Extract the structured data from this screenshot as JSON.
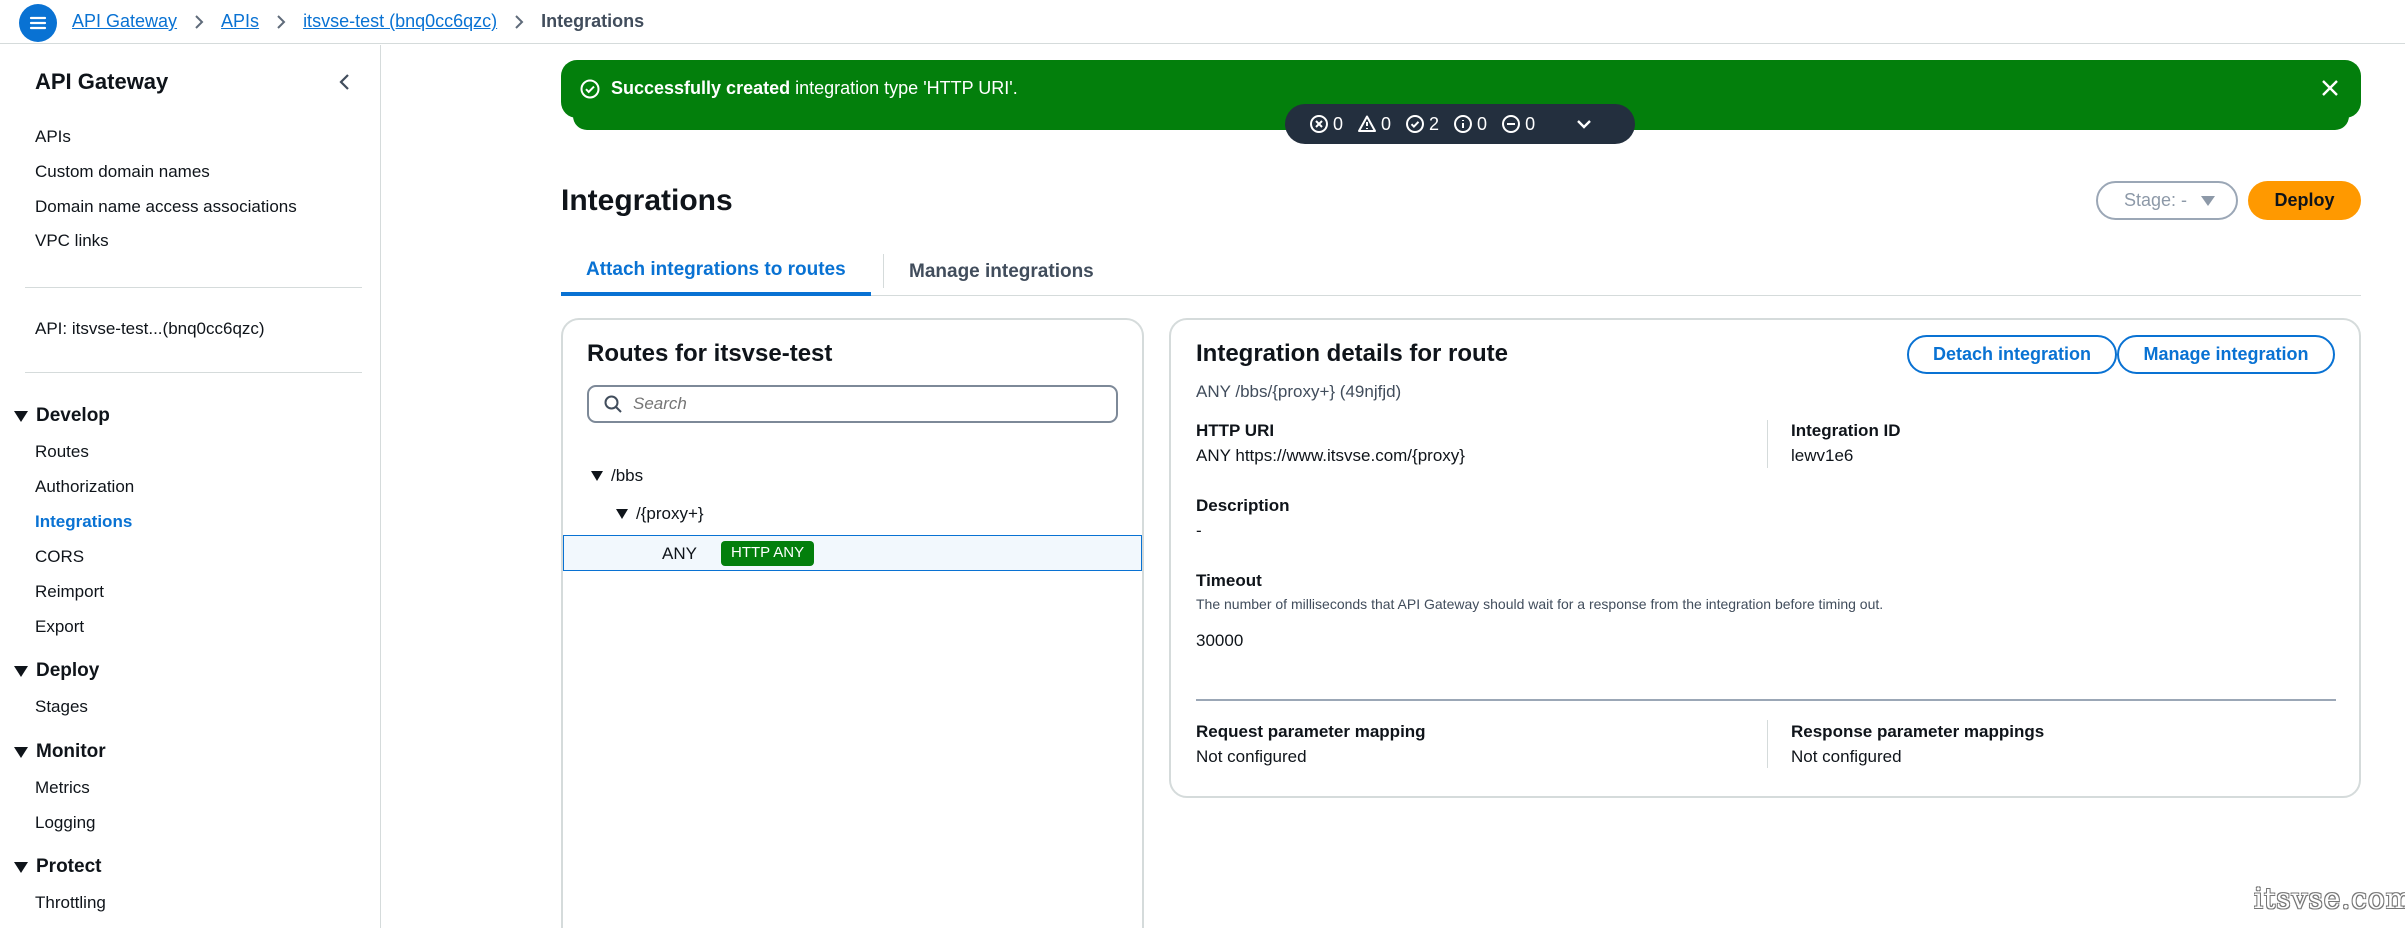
{
  "breadcrumb": {
    "items": [
      "API Gateway",
      "APIs",
      "itsvse-test (bnq0cc6qzc)"
    ],
    "current": "Integrations"
  },
  "sidebar": {
    "title": "API Gateway",
    "top_links": [
      "APIs",
      "Custom domain names",
      "Domain name access associations",
      "VPC links"
    ],
    "api_link": "API: itsvse-test...(bnq0cc6qzc)",
    "sections": [
      {
        "title": "Develop",
        "items": [
          "Routes",
          "Authorization",
          "Integrations",
          "CORS",
          "Reimport",
          "Export"
        ]
      },
      {
        "title": "Deploy",
        "items": [
          "Stages"
        ]
      },
      {
        "title": "Monitor",
        "items": [
          "Metrics",
          "Logging"
        ]
      },
      {
        "title": "Protect",
        "items": [
          "Throttling"
        ]
      }
    ],
    "active_item": "Integrations"
  },
  "flash": {
    "bold": "Successfully created",
    "text": " integration type 'HTTP URI'.",
    "color": "#037f0c"
  },
  "notification_counter": {
    "error": "0",
    "warning": "0",
    "success": "2",
    "info": "0",
    "in_progress": "0"
  },
  "header": {
    "title": "Integrations",
    "stage_select": "Stage: -",
    "deploy_label": "Deploy"
  },
  "tabs": [
    "Attach integrations to routes",
    "Manage integrations"
  ],
  "routes_panel": {
    "title": "Routes for itsvse-test",
    "search_placeholder": "Search",
    "tree": {
      "root": "/bbs",
      "child": "/{proxy+}",
      "method": "ANY",
      "badge": "HTTP ANY"
    }
  },
  "details_panel": {
    "title": "Integration details for route",
    "route_id": "ANY /bbs/{proxy+} (49njfjd)",
    "detach_label": "Detach integration",
    "manage_label": "Manage integration",
    "http_uri_label": "HTTP URI",
    "http_uri_value": "ANY https://www.itsvse.com/{proxy}",
    "integration_id_label": "Integration ID",
    "integration_id_value": "lewv1e6",
    "description_label": "Description",
    "description_value": "-",
    "timeout_label": "Timeout",
    "timeout_desc": "The number of milliseconds that API Gateway should wait for a response from the integration before timing out.",
    "timeout_value": "30000",
    "request_mapping_label": "Request parameter mapping",
    "request_mapping_value": "Not configured",
    "response_mapping_label": "Response parameter mappings",
    "response_mapping_value": "Not configured"
  },
  "watermark": "itsvse.com",
  "colors": {
    "accent": "#0972d3",
    "deploy": "#ff9900",
    "success": "#037f0c",
    "nav_dark": "#232f3e"
  }
}
